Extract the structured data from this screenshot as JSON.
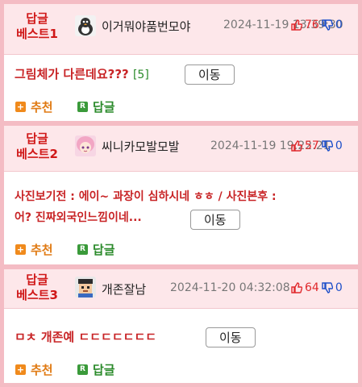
{
  "posts": [
    {
      "rank": "답글\n베스트1",
      "rank_line1": "답글",
      "rank_line2": "베스트1",
      "author": "이거뭐야품번모야",
      "avatar_icon": "penguin-avatar-icon",
      "timestamp": "2024-11-19 13:39:30",
      "upvotes": "76",
      "downvotes": "0",
      "title": "그림체가 다른데요???",
      "comment_count": "[5]",
      "move_label": "이동",
      "recommend_label": "추천",
      "reply_label": "답글"
    },
    {
      "rank_line1": "답글",
      "rank_line2": "베스트2",
      "author": "씨니카모발모발",
      "avatar_icon": "anime-girl-avatar-icon",
      "timestamp": "2024-11-19 19:22:21",
      "upvotes": "57",
      "downvotes": "0",
      "title_line1": "사진보기전 : 에이~ 과장이 심하시네 ㅎㅎ / 사진본후 :",
      "title_line2": "어? 진짜외국인느낌이네...",
      "move_label": "이동",
      "recommend_label": "추천",
      "reply_label": "답글"
    },
    {
      "rank_line1": "답글",
      "rank_line2": "베스트3",
      "author": "개존잘남",
      "avatar_icon": "pixel-character-avatar-icon",
      "timestamp": "2024-11-20 04:32:08",
      "upvotes": "64",
      "downvotes": "0",
      "title": "ㅁㅊ 개존예 ㄷㄷㄷㄷㄷㄷㄷ",
      "move_label": "이동",
      "recommend_label": "추천",
      "reply_label": "답글"
    }
  ],
  "colors": {
    "accent_red": "#d01818",
    "header_bg": "#fde7ea",
    "frame_bg": "#f4bcc4",
    "recommend": "#e07b14",
    "reply": "#2a8a2a",
    "downvote": "#1d4fc9"
  }
}
